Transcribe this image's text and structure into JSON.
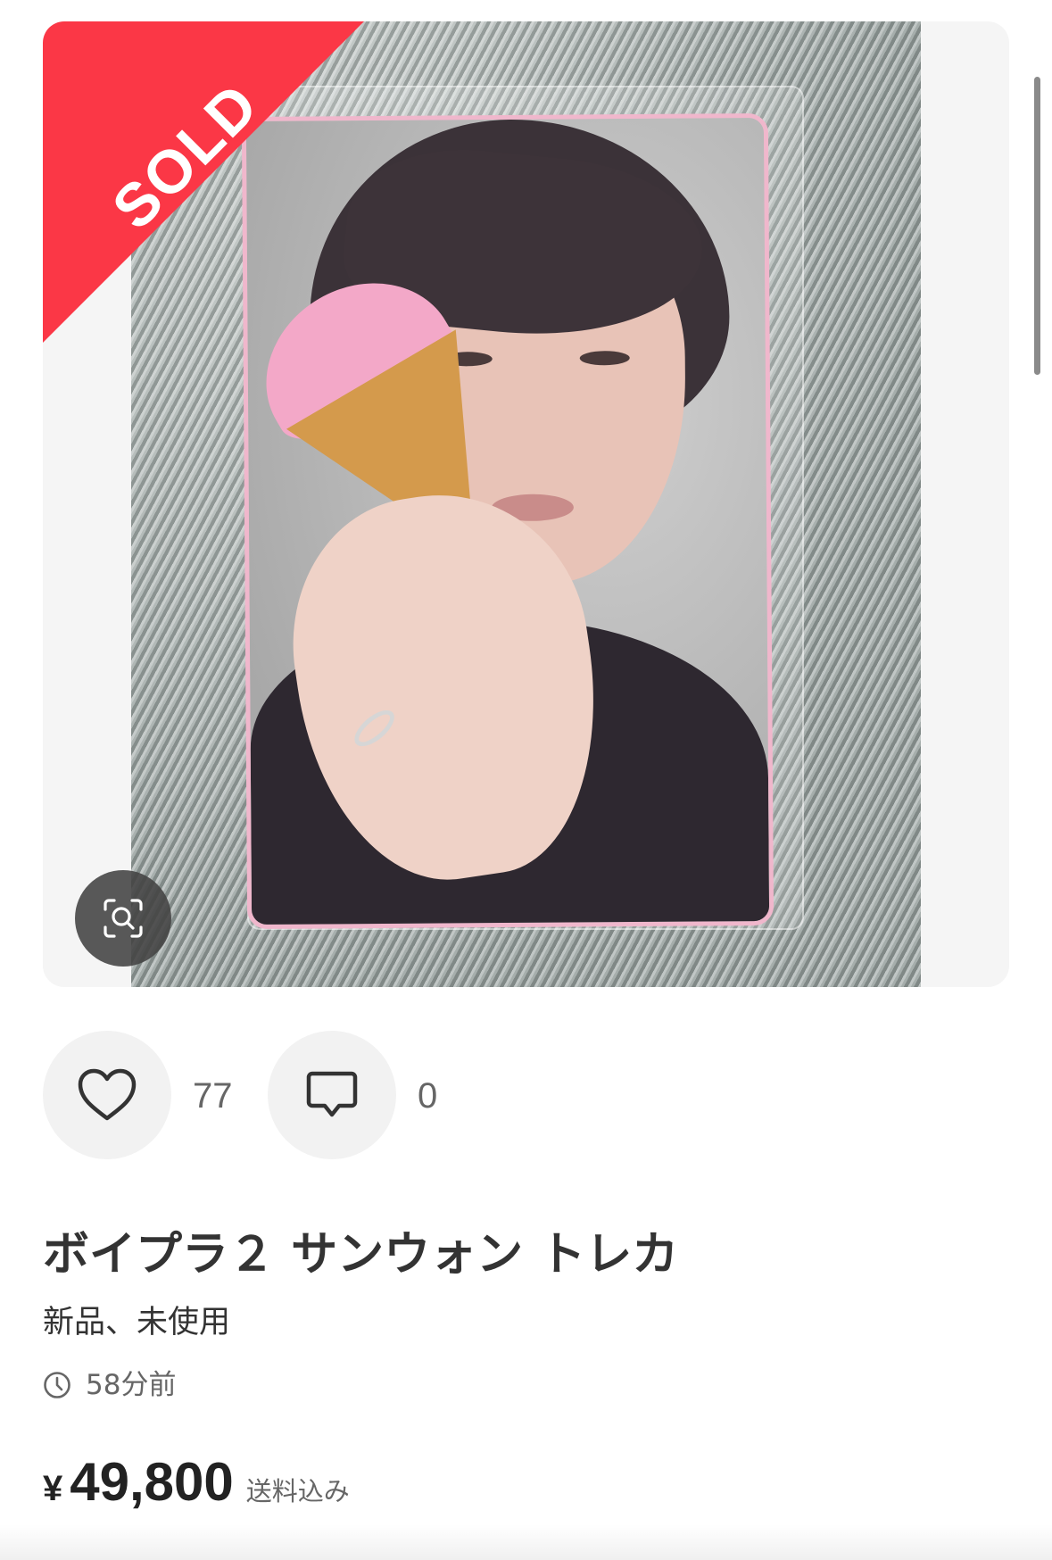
{
  "gallery": {
    "sold_label": "SOLD",
    "zoom_icon": "zoom-search-icon"
  },
  "actions": {
    "like_icon": "heart-icon",
    "like_count": "77",
    "comment_icon": "comment-icon",
    "comment_count": "0"
  },
  "item": {
    "title": "ボイプラ２ サンウォン トレカ",
    "condition": "新品、未使用",
    "time_icon": "clock-icon",
    "posted_ago": "58分前",
    "currency_symbol": "¥",
    "price": "49,800",
    "shipping_note": "送料込み"
  },
  "colors": {
    "sold_ribbon": "#fb3746",
    "text_primary": "#333333",
    "text_secondary": "#666666",
    "button_bg": "#f2f2f2"
  }
}
